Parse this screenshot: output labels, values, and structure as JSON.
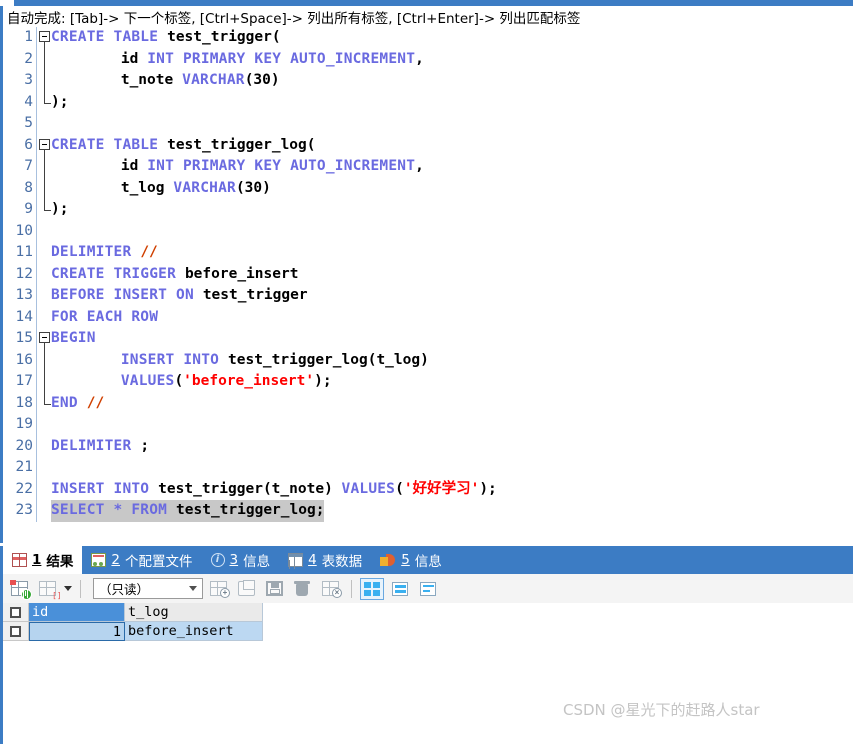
{
  "autocomplete_hint": "自动完成: [Tab]-> 下一个标签, [Ctrl+Space]-> 列出所有标签, [Ctrl+Enter]-> 列出匹配标签",
  "colors": {
    "accent_blue": "#3c7cc4",
    "keyword": "#6a6ae0",
    "string": "#ff0000",
    "operator": "#d04000",
    "identifier": "#000000",
    "gutter_number": "#4a6fa5",
    "selection": "#c8c8c8",
    "header_selected": "#4a90d9",
    "row_selected": "#bcd8f2"
  },
  "editor": {
    "lines": [
      {
        "n": "1",
        "fold": "start",
        "tokens": [
          {
            "t": "CREATE TABLE ",
            "c": "kw"
          },
          {
            "t": "test_trigger",
            "c": "id"
          },
          {
            "t": "(",
            "c": "pun"
          }
        ]
      },
      {
        "n": "2",
        "fold": "mid",
        "tokens": [
          {
            "t": "        ",
            "c": "pun"
          },
          {
            "t": "id",
            "c": "id"
          },
          {
            "t": " INT PRIMARY KEY AUTO_INCREMENT",
            "c": "kw"
          },
          {
            "t": ",",
            "c": "pun"
          }
        ]
      },
      {
        "n": "3",
        "fold": "mid",
        "tokens": [
          {
            "t": "        ",
            "c": "pun"
          },
          {
            "t": "t_note",
            "c": "id"
          },
          {
            "t": " VARCHAR",
            "c": "kw"
          },
          {
            "t": "(30)",
            "c": "pun"
          }
        ]
      },
      {
        "n": "4",
        "fold": "end",
        "tokens": [
          {
            "t": ");",
            "c": "pun"
          }
        ]
      },
      {
        "n": "5",
        "fold": "none",
        "tokens": []
      },
      {
        "n": "6",
        "fold": "start",
        "tokens": [
          {
            "t": "CREATE TABLE ",
            "c": "kw"
          },
          {
            "t": "test_trigger_log",
            "c": "id"
          },
          {
            "t": "(",
            "c": "pun"
          }
        ]
      },
      {
        "n": "7",
        "fold": "mid",
        "tokens": [
          {
            "t": "        ",
            "c": "pun"
          },
          {
            "t": "id",
            "c": "id"
          },
          {
            "t": " INT PRIMARY KEY AUTO_INCREMENT",
            "c": "kw"
          },
          {
            "t": ",",
            "c": "pun"
          }
        ]
      },
      {
        "n": "8",
        "fold": "mid",
        "tokens": [
          {
            "t": "        ",
            "c": "pun"
          },
          {
            "t": "t_log",
            "c": "id"
          },
          {
            "t": " VARCHAR",
            "c": "kw"
          },
          {
            "t": "(30)",
            "c": "pun"
          }
        ]
      },
      {
        "n": "9",
        "fold": "end",
        "tokens": [
          {
            "t": ");",
            "c": "pun"
          }
        ]
      },
      {
        "n": "10",
        "fold": "none",
        "tokens": []
      },
      {
        "n": "11",
        "fold": "none",
        "tokens": [
          {
            "t": "DELIMITER ",
            "c": "kw"
          },
          {
            "t": "//",
            "c": "op"
          }
        ]
      },
      {
        "n": "12",
        "fold": "none",
        "tokens": [
          {
            "t": "CREATE TRIGGER ",
            "c": "kw"
          },
          {
            "t": "before_insert",
            "c": "id"
          }
        ]
      },
      {
        "n": "13",
        "fold": "none",
        "tokens": [
          {
            "t": "BEFORE INSERT ON ",
            "c": "kw"
          },
          {
            "t": "test_trigger",
            "c": "id"
          }
        ]
      },
      {
        "n": "14",
        "fold": "none",
        "tokens": [
          {
            "t": "FOR EACH ROW",
            "c": "kw"
          }
        ]
      },
      {
        "n": "15",
        "fold": "start",
        "tokens": [
          {
            "t": "BEGIN",
            "c": "kw"
          }
        ]
      },
      {
        "n": "16",
        "fold": "mid",
        "tokens": [
          {
            "t": "        ",
            "c": "pun"
          },
          {
            "t": "INSERT INTO ",
            "c": "kw"
          },
          {
            "t": "test_trigger_log",
            "c": "id"
          },
          {
            "t": "(",
            "c": "pun"
          },
          {
            "t": "t_log",
            "c": "id"
          },
          {
            "t": ")",
            "c": "pun"
          }
        ]
      },
      {
        "n": "17",
        "fold": "mid",
        "tokens": [
          {
            "t": "        ",
            "c": "pun"
          },
          {
            "t": "VALUES",
            "c": "kw"
          },
          {
            "t": "(",
            "c": "pun"
          },
          {
            "t": "'before_insert'",
            "c": "str"
          },
          {
            "t": ");",
            "c": "pun"
          }
        ]
      },
      {
        "n": "18",
        "fold": "end",
        "tokens": [
          {
            "t": "END ",
            "c": "kw"
          },
          {
            "t": "//",
            "c": "op"
          }
        ]
      },
      {
        "n": "19",
        "fold": "none",
        "tokens": []
      },
      {
        "n": "20",
        "fold": "none",
        "tokens": [
          {
            "t": "DELIMITER ",
            "c": "kw"
          },
          {
            "t": ";",
            "c": "pun"
          }
        ]
      },
      {
        "n": "21",
        "fold": "none",
        "tokens": []
      },
      {
        "n": "22",
        "fold": "none",
        "tokens": [
          {
            "t": "INSERT INTO ",
            "c": "kw"
          },
          {
            "t": "test_trigger",
            "c": "id"
          },
          {
            "t": "(",
            "c": "pun"
          },
          {
            "t": "t_note",
            "c": "id"
          },
          {
            "t": ") ",
            "c": "pun"
          },
          {
            "t": "VALUES",
            "c": "kw"
          },
          {
            "t": "(",
            "c": "pun"
          },
          {
            "t": "'好好学习'",
            "c": "str"
          },
          {
            "t": ");",
            "c": "pun"
          }
        ]
      },
      {
        "n": "23",
        "fold": "none",
        "selected": true,
        "tokens": [
          {
            "t": "SELECT * FROM ",
            "c": "kw"
          },
          {
            "t": "test_trigger_log",
            "c": "id"
          },
          {
            "t": ";",
            "c": "pun"
          }
        ]
      }
    ]
  },
  "results_tabs": [
    {
      "num": "1",
      "label": "结果",
      "icon": "result-grid-icon",
      "active": true
    },
    {
      "num": "2",
      "label": "个配置文件",
      "icon": "profile-icon",
      "active": false
    },
    {
      "num": "3",
      "label": "信息",
      "icon": "info-circle-icon",
      "active": false
    },
    {
      "num": "4",
      "label": "表数据",
      "icon": "table-data-icon",
      "active": false
    },
    {
      "num": "5",
      "label": "信息",
      "icon": "chart-pie-icon",
      "active": false
    }
  ],
  "grid_toolbar": {
    "add_record_icon": "add-record-icon",
    "delete_record_icon": "delete-record-icon",
    "mode_value": "（只读）",
    "buttons": [
      {
        "name": "new-record-icon"
      },
      {
        "name": "import-record-icon"
      },
      {
        "name": "save-record-icon"
      },
      {
        "name": "delete-row-icon"
      },
      {
        "name": "cancel-record-icon"
      }
    ],
    "view_buttons": [
      {
        "name": "grid-view-icon",
        "active": true
      },
      {
        "name": "form-view-icon",
        "active": false
      },
      {
        "name": "text-view-icon",
        "active": false
      }
    ]
  },
  "data_grid": {
    "columns": [
      "id",
      "t_log"
    ],
    "selected_column": "id",
    "rows": [
      {
        "id": "1",
        "t_log": "before_insert"
      }
    ]
  },
  "watermark": "CSDN @星光下的赶路人star"
}
